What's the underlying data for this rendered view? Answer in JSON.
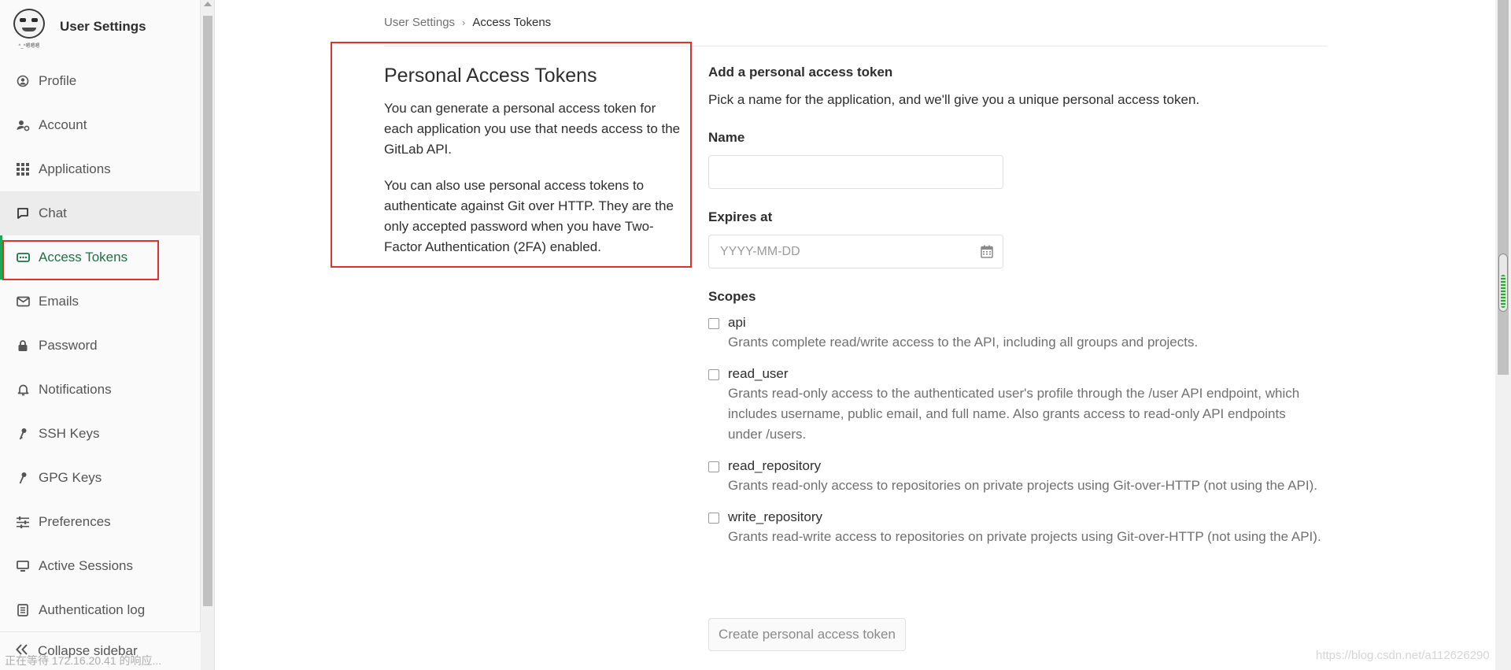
{
  "sidebar": {
    "title": "User Settings",
    "avatar_caption": "^_^嗯嗯嗯",
    "items": [
      {
        "label": "Profile",
        "icon": "profile-icon"
      },
      {
        "label": "Account",
        "icon": "account-icon"
      },
      {
        "label": "Applications",
        "icon": "applications-icon"
      },
      {
        "label": "Chat",
        "icon": "chat-icon"
      },
      {
        "label": "Access Tokens",
        "icon": "token-icon"
      },
      {
        "label": "Emails",
        "icon": "mail-icon"
      },
      {
        "label": "Password",
        "icon": "lock-icon"
      },
      {
        "label": "Notifications",
        "icon": "bell-icon"
      },
      {
        "label": "SSH Keys",
        "icon": "key-icon"
      },
      {
        "label": "GPG Keys",
        "icon": "key-icon"
      },
      {
        "label": "Preferences",
        "icon": "sliders-icon"
      },
      {
        "label": "Active Sessions",
        "icon": "monitor-icon"
      },
      {
        "label": "Authentication log",
        "icon": "log-icon"
      }
    ],
    "active_item": "Access Tokens",
    "collapse_label": "Collapse sidebar",
    "status_text": "正在等待 172.16.20.41 的响应..."
  },
  "breadcrumb": {
    "parent": "User Settings",
    "current": "Access Tokens"
  },
  "intro": {
    "title": "Personal Access Tokens",
    "paragraph1": "You can generate a personal access token for each application you use that needs access to the GitLab API.",
    "paragraph2": "You can also use personal access tokens to authenticate against Git over HTTP. They are the only accepted password when you have Two-Factor Authentication (2FA) enabled."
  },
  "form": {
    "heading": "Add a personal access token",
    "intro": "Pick a name for the application, and we'll give you a unique personal access token.",
    "name_label": "Name",
    "name_value": "",
    "expires_label": "Expires at",
    "expires_placeholder": "YYYY-MM-DD",
    "scopes_label": "Scopes",
    "scopes": [
      {
        "name": "api",
        "desc": "Grants complete read/write access to the API, including all groups and projects.",
        "checked": false
      },
      {
        "name": "read_user",
        "desc": "Grants read-only access to the authenticated user's profile through the /user API endpoint, which includes username, public email, and full name. Also grants access to read-only API endpoints under /users.",
        "checked": false
      },
      {
        "name": "read_repository",
        "desc": "Grants read-only access to repositories on private projects using Git-over-HTTP (not using the API).",
        "checked": false
      },
      {
        "name": "write_repository",
        "desc": "Grants read-write access to repositories on private projects using Git-over-HTTP (not using the API).",
        "checked": false
      }
    ],
    "submit_label": "Create personal access token"
  },
  "watermark": "https://blog.csdn.net/a112626290",
  "colors": {
    "accent_green": "#1aaa55",
    "active_text": "#1f7144",
    "highlight_red": "#e0302f"
  }
}
